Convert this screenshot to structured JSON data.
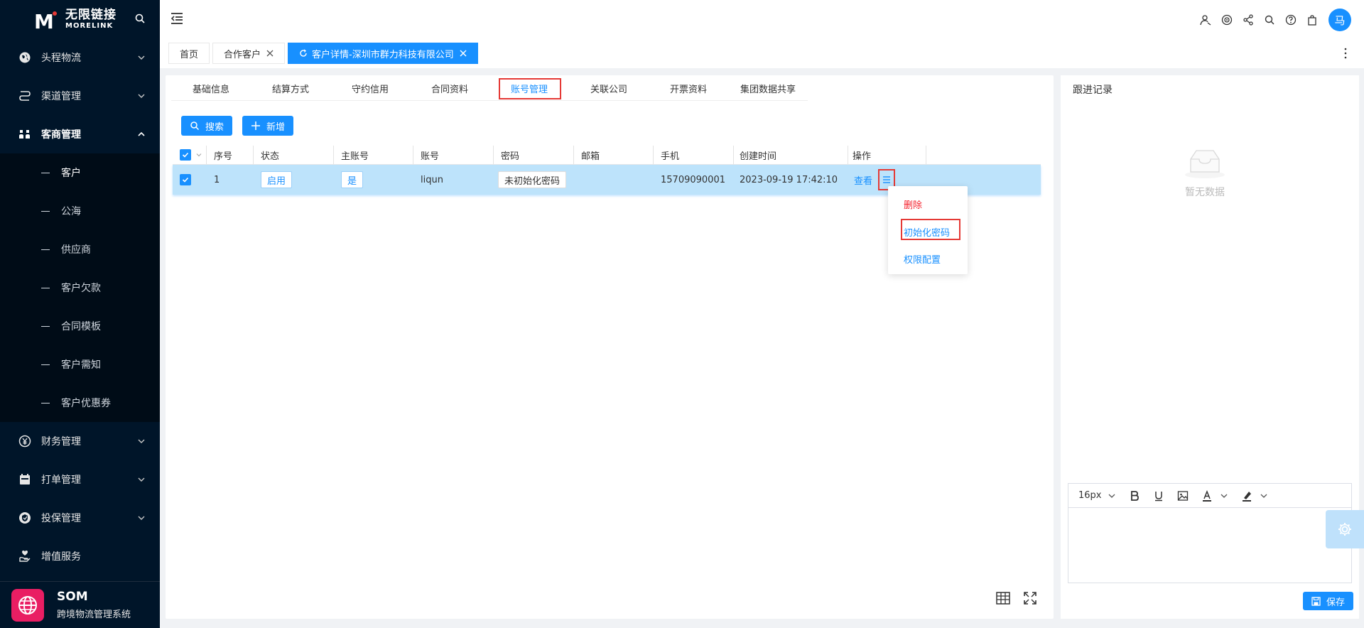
{
  "logo": {
    "cn": "无限链接",
    "en": "MORELINK",
    "mark": "M"
  },
  "sidebar": {
    "items_top": [
      {
        "label": "头程物流",
        "icon": "globe-icon"
      },
      {
        "label": "渠道管理",
        "icon": "route-icon"
      }
    ],
    "open_item": {
      "label": "客商管理",
      "icon": "users-icon"
    },
    "sub_items": [
      {
        "label": "客户"
      },
      {
        "label": "公海"
      },
      {
        "label": "供应商"
      },
      {
        "label": "客户欠款"
      },
      {
        "label": "合同模板"
      },
      {
        "label": "客户需知"
      },
      {
        "label": "客户优惠券"
      }
    ],
    "items_bottom": [
      {
        "label": "财务管理",
        "icon": "yen-icon"
      },
      {
        "label": "打单管理",
        "icon": "calendar-icon"
      },
      {
        "label": "投保管理",
        "icon": "shield-icon"
      },
      {
        "label": "增值服务",
        "icon": "hand-heart-icon"
      }
    ]
  },
  "brand": {
    "title": "SOM",
    "subtitle": "跨境物流管理系统"
  },
  "topbar": {
    "avatar": "马"
  },
  "tags": {
    "home": "首页",
    "partner": "合作客户",
    "active": "客户详情-深圳市群力科技有限公司"
  },
  "detail_tabs": [
    "基础信息",
    "结算方式",
    "守约信用",
    "合同资料",
    "账号管理",
    "关联公司",
    "开票资料",
    "集团数据共享"
  ],
  "toolbar": {
    "search": "搜索",
    "add": "新增"
  },
  "table": {
    "headers": [
      "序号",
      "状态",
      "主账号",
      "账号",
      "密码",
      "邮箱",
      "手机",
      "创建时间",
      "操作"
    ],
    "row": {
      "index": "1",
      "status": "启用",
      "is_main": "是",
      "account": "liqun",
      "password": "未初始化密码",
      "email": "",
      "phone": "15709090001",
      "created": "2023-09-19 17:42:10",
      "view": "查看"
    }
  },
  "dropdown": {
    "delete": "删除",
    "init_password": "初始化密码",
    "permissions": "权限配置"
  },
  "right_panel": {
    "title": "跟进记录",
    "empty": "暂无数据",
    "font_size": "16px",
    "save": "保存"
  }
}
